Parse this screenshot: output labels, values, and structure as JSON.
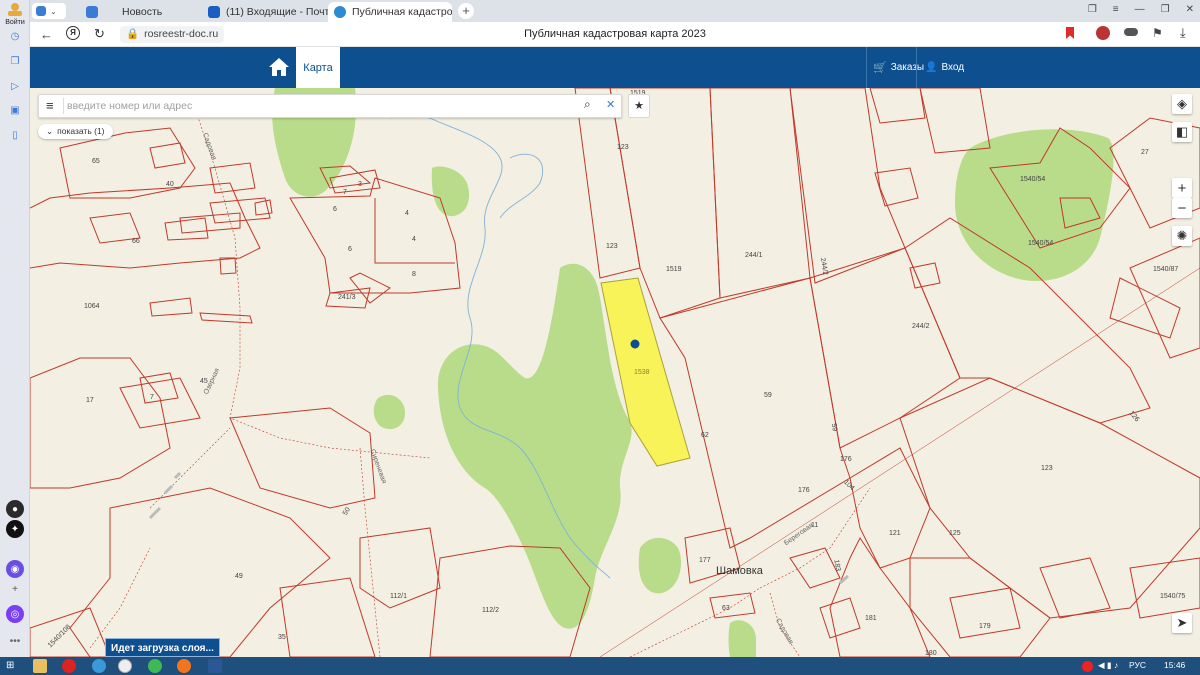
{
  "sidebar": {
    "profile_label": "Войти"
  },
  "tabs": [
    {
      "label": "Новость"
    },
    {
      "label": "(11) Входящие - Почта М"
    },
    {
      "label": "Публичная кадастровая"
    }
  ],
  "address_bar": {
    "url": "rosreestr-doc.ru",
    "page_title": "Публичная кадастровая карта 2023"
  },
  "site_header": {
    "map_tab": "Карта",
    "orders_label": "Заказы",
    "login_label": "Вход"
  },
  "map": {
    "search_placeholder": "введите номер или адрес",
    "show_label": "показать (1)",
    "loading_text": "Идет загрузка слоя...",
    "zoom_in": "+",
    "zoom_out": "−",
    "labels": [
      {
        "id": "l65",
        "text": "65"
      },
      {
        "id": "l40",
        "text": "40"
      },
      {
        "id": "l3",
        "text": "3"
      },
      {
        "id": "l7a",
        "text": "7"
      },
      {
        "id": "l6a",
        "text": "6"
      },
      {
        "id": "l4a",
        "text": "4"
      },
      {
        "id": "l4b",
        "text": "4"
      },
      {
        "id": "l6b",
        "text": "6"
      },
      {
        "id": "l8",
        "text": "8"
      },
      {
        "id": "l66",
        "text": "66"
      },
      {
        "id": "l1064",
        "text": "1064"
      },
      {
        "id": "l241_3",
        "text": "241/3"
      },
      {
        "id": "l123a",
        "text": "123"
      },
      {
        "id": "l123b",
        "text": "123"
      },
      {
        "id": "l1519",
        "text": "1519"
      },
      {
        "id": "l1519top",
        "text": "1519"
      },
      {
        "id": "l244_1",
        "text": "244/1"
      },
      {
        "id": "l244_2a",
        "text": "244/2"
      },
      {
        "id": "l244_2b",
        "text": "244/2"
      },
      {
        "id": "l1540_54a",
        "text": "1540/54"
      },
      {
        "id": "l1540_54b",
        "text": "1540/54"
      },
      {
        "id": "l27",
        "text": "27"
      },
      {
        "id": "l1540_87",
        "text": "1540/87"
      },
      {
        "id": "l1538",
        "text": "1538"
      },
      {
        "id": "l59a",
        "text": "59"
      },
      {
        "id": "l59b",
        "text": "59"
      },
      {
        "id": "l62",
        "text": "62"
      },
      {
        "id": "l17",
        "text": "17"
      },
      {
        "id": "l7b",
        "text": "7"
      },
      {
        "id": "l45",
        "text": "45"
      },
      {
        "id": "l126",
        "text": "126"
      },
      {
        "id": "l123c",
        "text": "123"
      },
      {
        "id": "l176a",
        "text": "176"
      },
      {
        "id": "l176b",
        "text": "176"
      },
      {
        "id": "l104",
        "text": "104"
      },
      {
        "id": "l11",
        "text": "11"
      },
      {
        "id": "l121",
        "text": "121"
      },
      {
        "id": "l125",
        "text": "125"
      },
      {
        "id": "l177",
        "text": "177"
      },
      {
        "id": "l183",
        "text": "183"
      },
      {
        "id": "l1540_75",
        "text": "1540/75"
      },
      {
        "id": "l63",
        "text": "63"
      },
      {
        "id": "l181",
        "text": "181"
      },
      {
        "id": "l179",
        "text": "179"
      },
      {
        "id": "l180",
        "text": "180"
      },
      {
        "id": "l49",
        "text": "49"
      },
      {
        "id": "l35",
        "text": "35"
      },
      {
        "id": "l112_1",
        "text": "112/1"
      },
      {
        "id": "l112_2",
        "text": "112/2"
      },
      {
        "id": "l50",
        "text": "50"
      },
      {
        "id": "l1540_108",
        "text": "1540/108"
      }
    ],
    "place_name": "Шамовка",
    "street_names": [
      "Садовая",
      "Озерная",
      "Сиреневая",
      "Береговая",
      "Садовая"
    ]
  },
  "taskbar": {
    "language": "РУС",
    "time": "15:46"
  },
  "colors": {
    "header_blue": "#0d4f8f",
    "parcel_border": "#c0392b",
    "selected_parcel": "#f7f358",
    "forest": "#b9dc8a",
    "map_bg": "#f3efe2"
  }
}
